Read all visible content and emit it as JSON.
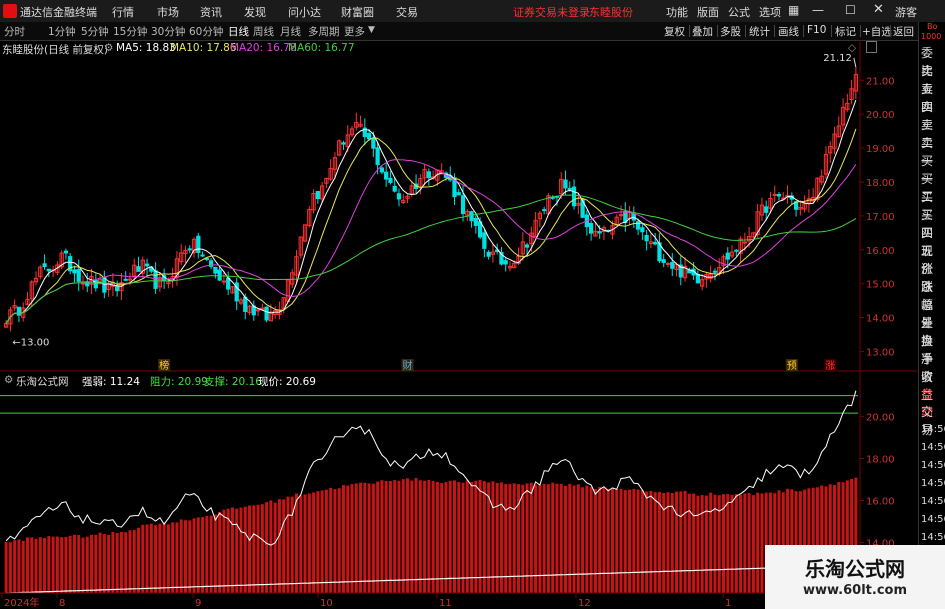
{
  "titlebar": {
    "app_name": "通达信金融终端",
    "menus": [
      "行情",
      "市场",
      "资讯",
      "发现",
      "问小达",
      "财富圈",
      "交易"
    ],
    "notice": "证券交易未登录",
    "stock_name": "东睦股份",
    "right_menus": [
      "功能",
      "版面",
      "公式",
      "选项"
    ],
    "guest": "游客"
  },
  "toolbar": {
    "periods": [
      "分时",
      "1分钟",
      "5分钟",
      "15分钟",
      "30分钟",
      "60分钟",
      "日线",
      "周线",
      "月线",
      "多周期",
      "更多"
    ],
    "active_period": "日线",
    "right_buttons": [
      "复权",
      "叠加",
      "多股",
      "统计",
      "画线",
      "F10",
      "标记",
      "+自选",
      "返回"
    ]
  },
  "right_panel": {
    "top_label": "Bo",
    "top_value": "1000",
    "items": [
      "委比",
      "卖五",
      "卖四",
      "卖三",
      "卖二",
      "卖一",
      "买一",
      "买二",
      "买三",
      "买四",
      "买五",
      "现价",
      "涨跌",
      "涨幅",
      "总量",
      "外盘",
      "换手",
      "净资",
      "收益"
    ],
    "lower_items": [
      "自动",
      "交易",
      "14:56",
      "14:56",
      "14:56",
      "14:56",
      "14:56",
      "14:56",
      "14:56",
      "14:56"
    ]
  },
  "price_header": {
    "title": "东睦股份(日线 前复权)",
    "ma": [
      {
        "label": "MA5: 18.83",
        "color": "#ffffff"
      },
      {
        "label": "MA10: 17.86",
        "color": "#e8e85a"
      },
      {
        "label": "MA20: 16.78",
        "color": "#e040e0"
      },
      {
        "label": "MA60: 16.77",
        "color": "#40d040"
      }
    ]
  },
  "indicator_header": {
    "title": "乐淘公式网",
    "items": [
      {
        "label": "强弱: 11.24",
        "color": "#ffffff"
      },
      {
        "label": "阻力: 20.99",
        "color": "#40e040"
      },
      {
        "label": "支撑: 20.16",
        "color": "#40e040"
      },
      {
        "label": "现价: 20.69",
        "color": "#ffffff"
      }
    ]
  },
  "markers": {
    "high_label": "21.12",
    "low_label": "13.00",
    "events": [
      {
        "text": "榜",
        "index": 37
      },
      {
        "text": "财",
        "index": 94
      },
      {
        "text": "预",
        "index": 184
      },
      {
        "text": "涨",
        "index": 193
      }
    ]
  },
  "chart_data": [
    {
      "type": "candlestick",
      "ylim": [
        12.6,
        21.6
      ],
      "y_ticks": [
        "21.00",
        "20.00",
        "19.00",
        "18.00",
        "17.00",
        "16.00",
        "15.00",
        "14.00",
        "13.00"
      ],
      "seed": [
        14.0,
        14.2,
        14.8,
        15.3,
        15.5,
        15.8,
        15.4,
        15.1,
        15.0,
        14.8,
        14.9,
        15.3,
        15.5,
        15.1,
        14.9,
        15.6,
        16.2,
        16.0,
        15.5,
        15.1,
        14.8,
        14.4,
        14.2,
        14.0,
        14.3,
        15.2,
        16.4,
        17.6,
        17.8,
        18.8,
        19.4,
        19.6,
        19.2,
        18.5,
        17.8,
        17.5,
        17.9,
        18.3,
        18.4,
        18.1,
        17.5,
        16.8,
        16.2,
        15.8,
        15.6,
        15.8,
        16.3,
        16.9,
        17.6,
        17.9,
        17.5,
        16.9,
        16.4,
        16.5,
        16.8,
        17.0,
        16.5,
        16.1,
        15.8,
        15.5,
        15.3,
        15.2,
        15.4,
        15.6,
        15.9,
        16.2,
        16.7,
        17.3,
        17.5,
        17.6,
        17.2,
        17.4,
        18.4,
        19.1,
        20.3,
        21.0
      ]
    },
    {
      "type": "bar+line",
      "ylim": [
        11.6,
        21.4
      ],
      "y_ticks": [
        "20.00",
        "18.00",
        "16.00",
        "14.00"
      ],
      "resistance": 20.99,
      "support": 20.16,
      "price_line": [
        14.0,
        14.2,
        14.8,
        15.3,
        15.5,
        15.8,
        15.4,
        15.1,
        15.0,
        14.8,
        14.9,
        15.3,
        15.5,
        15.1,
        14.9,
        15.6,
        16.2,
        16.0,
        15.5,
        15.1,
        14.8,
        14.4,
        14.2,
        14.0,
        14.3,
        15.2,
        16.4,
        17.6,
        17.8,
        18.8,
        19.4,
        19.6,
        19.2,
        18.5,
        17.8,
        17.5,
        17.9,
        18.3,
        18.4,
        18.1,
        17.5,
        16.8,
        16.2,
        15.8,
        15.6,
        15.8,
        16.3,
        16.9,
        17.6,
        17.9,
        17.5,
        16.9,
        16.4,
        16.5,
        16.8,
        17.0,
        16.5,
        16.1,
        15.8,
        15.5,
        15.3,
        15.2,
        15.4,
        15.6,
        15.9,
        16.2,
        16.7,
        17.3,
        17.5,
        17.6,
        17.2,
        17.4,
        18.4,
        19.1,
        20.3,
        21.0
      ],
      "bars": [
        14.0,
        14.1,
        14.2,
        14.2,
        14.3,
        14.3,
        14.3,
        14.3,
        14.4,
        14.4,
        14.5,
        14.6,
        14.8,
        14.9,
        14.9,
        15.0,
        15.1,
        15.2,
        15.3,
        15.5,
        15.6,
        15.7,
        15.8,
        15.9,
        16.0,
        16.2,
        16.3,
        16.4,
        16.5,
        16.6,
        16.7,
        16.8,
        16.8,
        16.9,
        17.0,
        17.0,
        17.0,
        17.0,
        16.9,
        16.9,
        16.9,
        16.9,
        16.9,
        16.9,
        16.8,
        16.8,
        16.8,
        16.8,
        16.8,
        16.8,
        16.7,
        16.7,
        16.6,
        16.6,
        16.6,
        16.5,
        16.5,
        16.4,
        16.4,
        16.4,
        16.4,
        16.3,
        16.3,
        16.3,
        16.3,
        16.3,
        16.3,
        16.4,
        16.4,
        16.5,
        16.5,
        16.6,
        16.7,
        16.8,
        16.9,
        17.1
      ]
    }
  ],
  "x_axis": {
    "labels": [
      "2024年",
      "8",
      "9",
      "10",
      "11",
      "12",
      "1"
    ]
  },
  "watermark": {
    "line1": "乐淘公式网",
    "line2": "www.60lt.com"
  },
  "colors": {
    "up": "#ff3232",
    "down": "#00e0e0",
    "bar": "#c81414",
    "grid": "#7a0000"
  }
}
